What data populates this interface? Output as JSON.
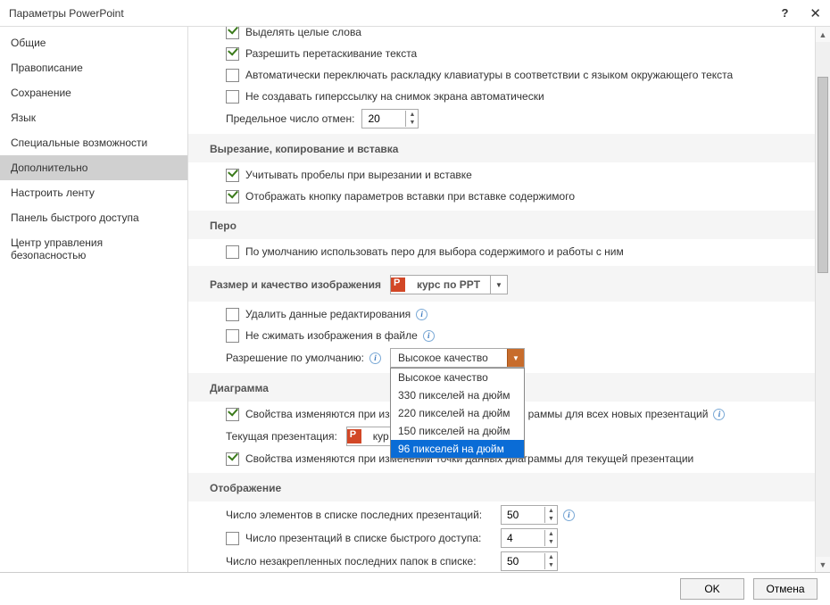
{
  "title": "Параметры PowerPoint",
  "helpGlyph": "?",
  "closeGlyph": "✕",
  "sidebar": {
    "items": [
      {
        "label": "Общие"
      },
      {
        "label": "Правописание"
      },
      {
        "label": "Сохранение"
      },
      {
        "label": "Язык"
      },
      {
        "label": "Специальные возможности"
      },
      {
        "label": "Дополнительно"
      },
      {
        "label": "Настроить ленту"
      },
      {
        "label": "Панель быстрого доступа"
      },
      {
        "label": "Центр управления безопасностью"
      }
    ],
    "selectedIndex": 5
  },
  "editing": {
    "wholeWords": "Выделять целые слова",
    "dragDrop": "Разрешить перетаскивание текста",
    "autoKeyboard": "Автоматически переключать раскладку клавиатуры в соответствии с языком окружающего текста",
    "noHyperlink": "Не создавать гиперссылку на снимок экрана автоматически",
    "undoLabel": "Предельное число отмен:",
    "undoValue": "20"
  },
  "clipboard": {
    "header": "Вырезание, копирование и вставка",
    "smartCut": "Учитывать пробелы при вырезании и вставке",
    "showPasteBtn": "Отображать кнопку параметров вставки при вставке содержимого"
  },
  "pen": {
    "header": "Перо",
    "defaultPen": "По умолчанию использовать перо для выбора содержимого и работы с ним"
  },
  "image": {
    "header": "Размер и качество изображения",
    "fileName": "курс по PPT",
    "discardEdit": "Удалить данные редактирования",
    "noCompress": "Не сжимать изображения в файле",
    "defaultResLabel": "Разрешение по умолчанию:",
    "defaultResValue": "Высокое качество",
    "options": [
      "Высокое качество",
      "330 пикселей на дюйм",
      "220 пикселей на дюйм",
      "150 пикселей на дюйм",
      "96 пикселей на дюйм"
    ],
    "optionSelectedIndex": 4
  },
  "chart": {
    "header": "Диаграмма",
    "propsAllPrefix": "Свойства изменяются при из",
    "propsAllSuffix": "раммы для всех новых презентаций",
    "currentLabel": "Текущая презентация:",
    "currentValPrefix": "кур",
    "propsCurrent": "Свойства изменяются при изменении точки данных диаграммы для текущей презентации"
  },
  "display": {
    "header": "Отображение",
    "recentCount": "Число элементов в списке последних презентаций:",
    "recentVal": "50",
    "quickCount": "Число презентаций в списке быстрого доступа:",
    "quickVal": "4",
    "unpinCount": "Число незакрепленных последних папок в списке:",
    "unpinVal": "50"
  },
  "footer": {
    "ok": "OK",
    "cancel": "Отмена"
  }
}
